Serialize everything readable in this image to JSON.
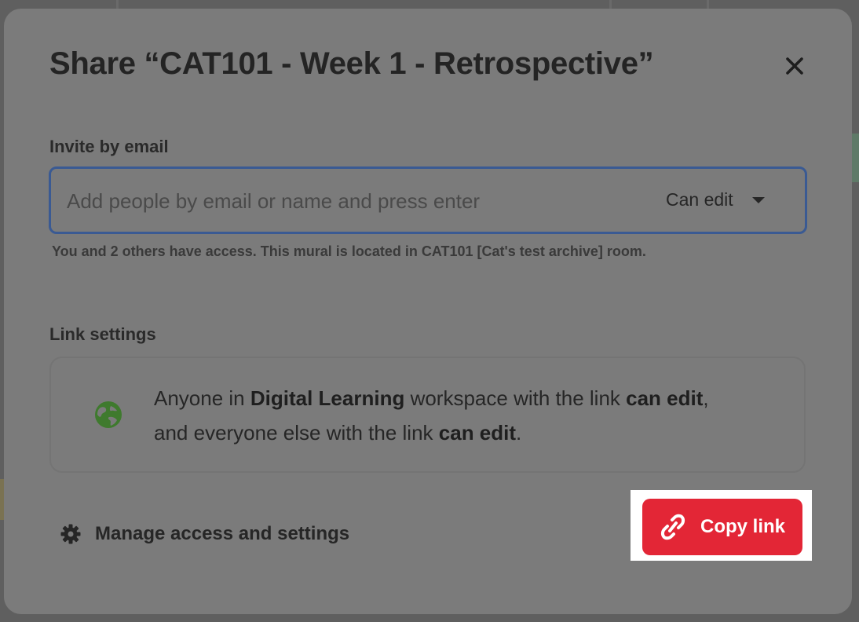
{
  "dialog": {
    "title": "Share “CAT101 - Week 1 - Retrospective”",
    "close_icon": "close-icon"
  },
  "invite": {
    "label": "Invite by email",
    "placeholder": "Add people by email or name and press enter",
    "value": "",
    "permission": "Can edit",
    "access_note": "You and 2 others have access. This mural is located in CAT101 [Cat's test archive] room."
  },
  "link_settings": {
    "label": "Link settings",
    "icon": "globe-icon",
    "icon_color": "#3f7a2e",
    "segments": {
      "s1": "Anyone in ",
      "workspace": "Digital Learning",
      "s2": " workspace with the link ",
      "perm1": "can edit",
      "s3": ",",
      "s4": "and everyone else with the link ",
      "perm2": "can edit",
      "s5": "."
    }
  },
  "footer": {
    "manage_label": "Manage access and settings",
    "manage_icon": "gear-icon",
    "copy_label": "Copy link",
    "copy_icon": "link-icon",
    "copy_color": "#e32636"
  }
}
